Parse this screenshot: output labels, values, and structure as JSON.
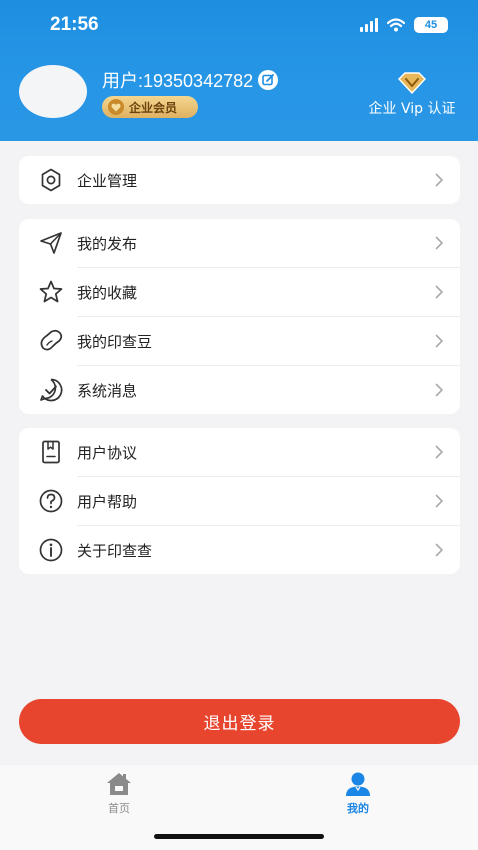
{
  "status_bar": {
    "time": "21:56",
    "battery": "45"
  },
  "profile": {
    "user_text": "用户:19350342782",
    "member_badge": "企业会员",
    "vip_label": "企业 Vip 认证"
  },
  "menu_groups": [
    [
      {
        "label": "企业管理",
        "icon": "gear-icon"
      }
    ],
    [
      {
        "label": "我的发布",
        "icon": "send-icon"
      },
      {
        "label": "我的收藏",
        "icon": "star-icon"
      },
      {
        "label": "我的印查豆",
        "icon": "bean-icon"
      },
      {
        "label": "系统消息",
        "icon": "message-check-icon"
      }
    ],
    [
      {
        "label": "用户协议",
        "icon": "document-icon"
      },
      {
        "label": "用户帮助",
        "icon": "help-icon"
      },
      {
        "label": "关于印查查",
        "icon": "info-icon"
      }
    ]
  ],
  "logout_label": "退出登录",
  "tabbar": {
    "home_label": "首页",
    "mine_label": "我的"
  },
  "colors": {
    "header": "#2796e6",
    "logout": "#e8452f",
    "tab_active": "#1b86e6",
    "badge_gold": "#dfb160"
  }
}
